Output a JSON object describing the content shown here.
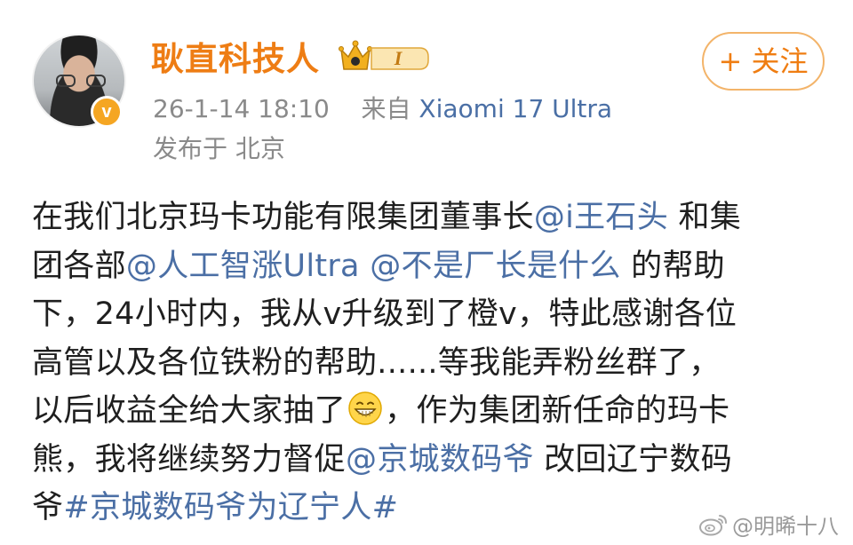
{
  "user": {
    "name": "耿直科技人",
    "level_badge_letter": "I",
    "verified_mark": "v"
  },
  "meta": {
    "timestamp": "26-1-14 18:10",
    "source_prefix": "来自",
    "source_device": "Xiaomi 17 Ultra",
    "location": "发布于 北京"
  },
  "follow_button": {
    "label": "+ 关注"
  },
  "post": {
    "line1": {
      "t1": "在我们北京玛卡功能有限集团董事长",
      "mention1": "@i王石头",
      "t2": " 和集"
    },
    "line2": {
      "t1": "团各部",
      "mention1": "@人工智涨Ultra",
      "t2": " ",
      "mention2": "@不是厂长是什么",
      "t3": " 的帮助"
    },
    "line3": {
      "t1": "下，24小时内，我从v升级到了橙v，特此感谢各位"
    },
    "line4": {
      "t1": "高管以及各位铁粉的帮助......等我能弄粉丝群了，"
    },
    "line5": {
      "t1": "以后收益全给大家抽了",
      "emoji": "grin-emoji",
      "t2": "，作为集团新任命的玛卡"
    },
    "line6": {
      "t1": "熊，我将继续努力督促",
      "mention1": "@京城数码爷",
      "t2": " 改回辽宁数码"
    },
    "line7": {
      "t1": "爷",
      "topic1": "#京城数码爷为辽宁人#"
    }
  },
  "watermark": {
    "text": "@明晞十八",
    "icon": "weibo-logo-icon"
  },
  "colors": {
    "username": "#ee7d14",
    "link": "#4b6fa5",
    "meta": "#8a8a8a",
    "follow_border": "#f3b46a",
    "follow_text": "#ef7d12"
  }
}
